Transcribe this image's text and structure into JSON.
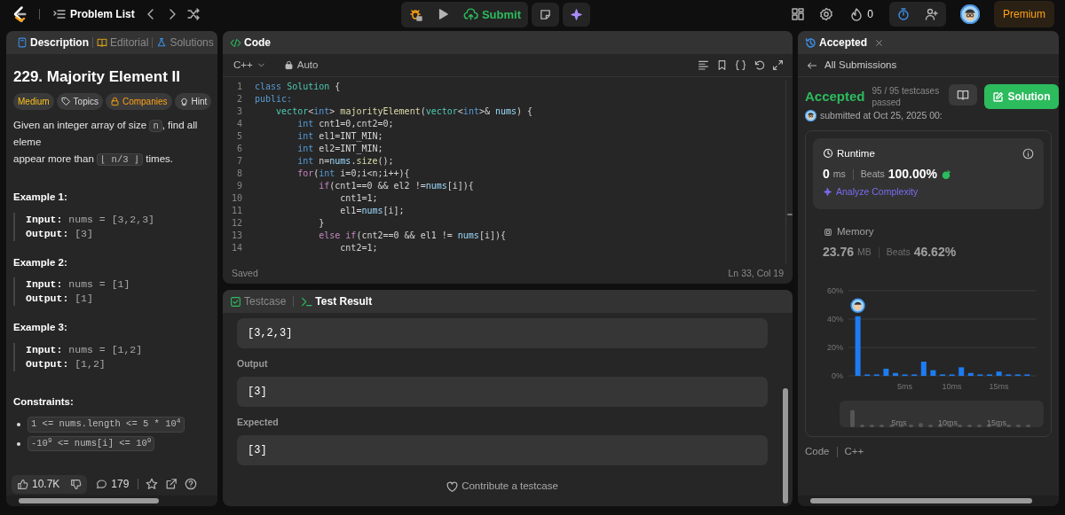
{
  "nav": {
    "problem_list": "Problem List",
    "submit": "Submit",
    "streak": "0",
    "premium": "Premium"
  },
  "left": {
    "tabs": [
      {
        "label": "Description",
        "selected": true
      },
      {
        "label": "Editorial",
        "selected": false
      },
      {
        "label": "Solutions",
        "selected": false
      }
    ],
    "title": "229. Majority Element II",
    "tags": [
      {
        "label": "Medium",
        "kind": "difficulty"
      },
      {
        "label": "Topics",
        "kind": "topics"
      },
      {
        "label": "Companies",
        "kind": "companies"
      },
      {
        "label": "Hint",
        "kind": "hint"
      }
    ],
    "description": [
      [
        {
          "text": "Given an integer array of size "
        },
        {
          "code": "n"
        },
        {
          "text": ", find all eleme"
        }
      ],
      [
        {
          "text": "appear more than "
        },
        {
          "code": "⌊ n/3 ⌋"
        },
        {
          "text": " times."
        }
      ]
    ],
    "examples": [
      {
        "heading": "Example 1:",
        "input_label": "Input:",
        "input": "nums = [3,2,3]",
        "output_label": "Output:",
        "output": "[3]"
      },
      {
        "heading": "Example 2:",
        "input_label": "Input:",
        "input": "nums = [1]",
        "output_label": "Output:",
        "output": "[1]"
      },
      {
        "heading": "Example 3:",
        "input_label": "Input:",
        "input": "nums = [1,2]",
        "output_label": "Output:",
        "output": "[1,2]"
      }
    ],
    "constraints_heading": "Constraints:",
    "constraints": [
      "1 <= nums.length <= 5 * 10$^{4}$",
      "-10$^{9}$ <= nums[i] <= 10$^{9}$"
    ],
    "footer": {
      "likes": "10.7K",
      "comments": "179"
    }
  },
  "code": {
    "title": "Code",
    "language": "C++",
    "mode": "Auto",
    "status": "Saved",
    "cursor": "Ln 33, Col 19",
    "lines": [
      {
        "num": "1",
        "tokens": [
          {
            "kind": "kw",
            "text": "class"
          },
          {
            "kind": "ty",
            "text": " Solution"
          },
          {
            "kind": "p",
            "text": " {"
          }
        ]
      },
      {
        "num": "2",
        "tokens": [
          {
            "kind": "kw",
            "text": "public:"
          }
        ]
      },
      {
        "num": "3",
        "tokens": [
          {
            "kind": "ty",
            "text": "    vector"
          },
          {
            "kind": "p",
            "text": "<"
          },
          {
            "kind": "kw",
            "text": "int"
          },
          {
            "kind": "p",
            "text": ">"
          },
          {
            "kind": "fn",
            "text": " majorityElement"
          },
          {
            "kind": "p",
            "text": "("
          },
          {
            "kind": "ty",
            "text": "vector"
          },
          {
            "kind": "p",
            "text": "<"
          },
          {
            "kind": "kw",
            "text": "int"
          },
          {
            "kind": "p",
            "text": ">&"
          },
          {
            "kind": "va",
            "text": " nums"
          },
          {
            "kind": "p",
            "text": ") {"
          }
        ]
      },
      {
        "num": "4",
        "tokens": [
          {
            "kind": "kw",
            "text": "        int"
          },
          {
            "kind": "p",
            "text": " cnt1=0,cnt2=0;"
          }
        ]
      },
      {
        "num": "5",
        "tokens": [
          {
            "kind": "kw",
            "text": "        int"
          },
          {
            "kind": "p",
            "text": " el1=INT_MIN;"
          }
        ]
      },
      {
        "num": "6",
        "tokens": [
          {
            "kind": "kw",
            "text": "        int"
          },
          {
            "kind": "p",
            "text": " el2=INT_MIN;"
          }
        ]
      },
      {
        "num": "7",
        "tokens": [
          {
            "kind": "kw",
            "text": "        int"
          },
          {
            "kind": "p",
            "text": " n="
          },
          {
            "kind": "va",
            "text": "nums"
          },
          {
            "kind": "p",
            "text": "."
          },
          {
            "kind": "fn",
            "text": "size"
          },
          {
            "kind": "p",
            "text": "();"
          }
        ]
      },
      {
        "num": "8",
        "tokens": [
          {
            "kind": "ct",
            "text": "        for"
          },
          {
            "kind": "p",
            "text": "("
          },
          {
            "kind": "kw",
            "text": "int"
          },
          {
            "kind": "p",
            "text": " i=0;i<n;i++){"
          }
        ]
      },
      {
        "num": "9",
        "tokens": [
          {
            "kind": "ct",
            "text": "            if"
          },
          {
            "kind": "p",
            "text": "(cnt1==0 && el2 !="
          },
          {
            "kind": "va",
            "text": "nums"
          },
          {
            "kind": "p",
            "text": "[i]){"
          }
        ]
      },
      {
        "num": "10",
        "tokens": [
          {
            "kind": "p",
            "text": "                cnt1=1;"
          }
        ]
      },
      {
        "num": "11",
        "tokens": [
          {
            "kind": "p",
            "text": "                el1="
          },
          {
            "kind": "va",
            "text": "nums"
          },
          {
            "kind": "p",
            "text": "[i];"
          }
        ]
      },
      {
        "num": "12",
        "tokens": [
          {
            "kind": "p",
            "text": "            }"
          }
        ]
      },
      {
        "num": "13",
        "tokens": [
          {
            "kind": "ct",
            "text": "            else if"
          },
          {
            "kind": "p",
            "text": "(cnt2==0 && el1 != "
          },
          {
            "kind": "va",
            "text": "nums"
          },
          {
            "kind": "p",
            "text": "[i]){"
          }
        ]
      },
      {
        "num": "14",
        "tokens": [
          {
            "kind": "p",
            "text": "                cnt2=1;"
          }
        ]
      }
    ]
  },
  "test": {
    "tabs": [
      {
        "label": "Testcase",
        "selected": false
      },
      {
        "label": "Test Result",
        "selected": true
      }
    ],
    "input_value": "[3,2,3]",
    "fields": [
      {
        "label": "Output",
        "value": "[3]"
      },
      {
        "label": "Expected",
        "value": "[3]"
      }
    ],
    "contribute": "Contribute a testcase"
  },
  "result": {
    "tab": "Accepted",
    "back": "All Submissions",
    "status": "Accepted",
    "testcases": "95 / 95 testcases passed",
    "solution": "Solution",
    "submitted": "submitted at Oct 25, 2025 00:",
    "stats": [
      {
        "kind": "runtime",
        "title": "Runtime",
        "value": "0",
        "unit": "ms",
        "beats_label": "Beats",
        "beats": "100.00%",
        "selected": true,
        "link": "Analyze Complexity"
      },
      {
        "kind": "memory",
        "title": "Memory",
        "value": "23.76",
        "unit": "MB",
        "beats_label": "Beats",
        "beats": "46.62%",
        "selected": false
      }
    ],
    "chart_data": {
      "type": "bar",
      "x": [
        0,
        1,
        2,
        3,
        4,
        5,
        6,
        7,
        8,
        9,
        10,
        11,
        12,
        13,
        14,
        15,
        16,
        17,
        18
      ],
      "series": [
        {
          "color": "#1d7cf2",
          "values": [
            42,
            1,
            1,
            5,
            2,
            1,
            1,
            10,
            4,
            1,
            1,
            6,
            2,
            1,
            1,
            3,
            1,
            1,
            1
          ]
        }
      ],
      "xlim": [
        -1,
        19
      ],
      "ylim": [
        0,
        60
      ],
      "yticks": [
        {
          "value": 0,
          "label": "0%"
        },
        {
          "value": 20,
          "label": "20%"
        },
        {
          "value": 40,
          "label": "40%"
        },
        {
          "value": 60,
          "label": "60%"
        }
      ],
      "xticks": [
        {
          "value": 5,
          "label": "5ms"
        },
        {
          "value": 10,
          "label": "10ms"
        },
        {
          "value": 15,
          "label": "15ms"
        }
      ]
    },
    "navigator_labels": [
      "5ms",
      "10ms",
      "15ms"
    ],
    "footer": {
      "label": "Code",
      "language": "C++"
    }
  }
}
